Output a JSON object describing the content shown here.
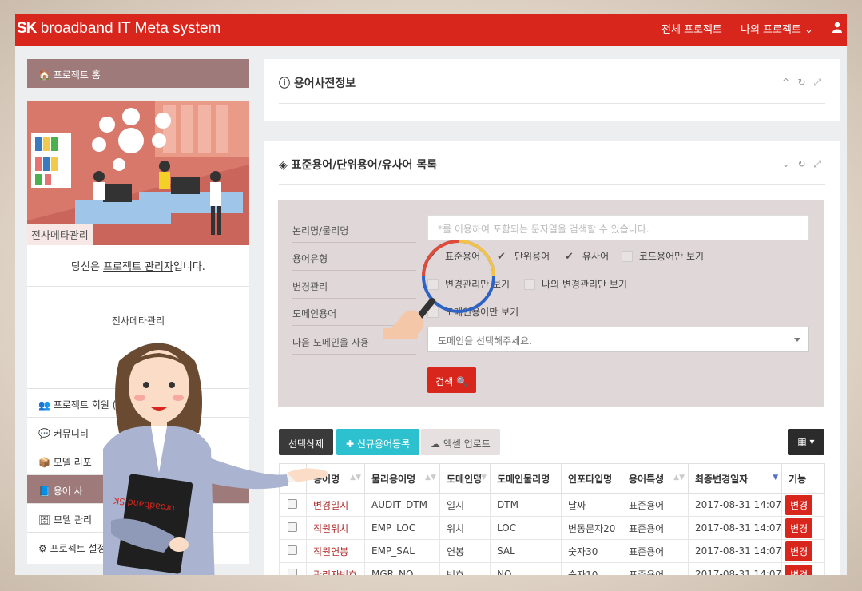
{
  "header": {
    "logo_main": "SK",
    "logo_rest": "broadband IT Meta system",
    "nav_all": "전체 프로젝트",
    "nav_mine": "나의 프로젝트 ⌄",
    "user_icon": "user-icon"
  },
  "sidebar": {
    "home": "🏠 프로젝트 홈",
    "illustration_label": "전사메타관리",
    "manager_prefix": "당신은 ",
    "manager_link": "프로젝트 관리자",
    "manager_suffix": "입니다.",
    "project_name": "전사메타관리",
    "menu": [
      {
        "label": "👥 프로젝트 회원 (1 /"
      },
      {
        "label": "💬 커뮤니티"
      },
      {
        "label": "📦 모델 리포"
      },
      {
        "label": "📘 용어 사"
      },
      {
        "label": "🗄 모델 관리"
      },
      {
        "label": "⚙ 프로젝트 설정"
      }
    ]
  },
  "panel1": {
    "title": "ⓘ 용어사전정보",
    "tools": "^ ↻ ⤢"
  },
  "panel2": {
    "title": "◈ 표준용어/단위용어/유사어 목록",
    "tools": "⌄ ↻ ⤢"
  },
  "search": {
    "labels": [
      "논리명/물리명",
      "용어유형",
      "변경관리",
      "도메인용어",
      "다음 도메인을 사용"
    ],
    "input_placeholder": "*를 이용하여 포함되는 문자열을 검색할 수 있습니다.",
    "type_options": [
      {
        "label": "표준용어",
        "checked": true
      },
      {
        "label": "단위용어",
        "checked": true
      },
      {
        "label": "유사어",
        "checked": true
      },
      {
        "label": "코드용어만 보기",
        "checked": false
      }
    ],
    "change_options": [
      {
        "label": "변경관리만 보기",
        "checked": false
      },
      {
        "label": "나의 변경관리만 보기",
        "checked": false
      }
    ],
    "domain_option": {
      "label": "도메인용어만 보기",
      "checked": false
    },
    "domain_select": "도메인을 선택해주세요.",
    "search_button": "검색 🔍"
  },
  "actions": {
    "delete_selected": "선택삭제",
    "new_term": "✚ 신규용어등록",
    "excel_upload": "☁ 엑셀 업로드",
    "grid": "▦ ▾"
  },
  "table": {
    "headers": [
      "용어명",
      "물리용어명",
      "도메인명",
      "도메인물리명",
      "인포타입명",
      "용어특성",
      "최종변경일자",
      "기능"
    ],
    "rows": [
      [
        "변경일시",
        "AUDIT_DTM",
        "일시",
        "DTM",
        "날짜",
        "표준용어",
        "2017-08-31 14:07",
        "변경"
      ],
      [
        "직원위치",
        "EMP_LOC",
        "위치",
        "LOC",
        "변동문자20",
        "표준용어",
        "2017-08-31 14:07",
        "변경"
      ],
      [
        "직원연봉",
        "EMP_SAL",
        "연봉",
        "SAL",
        "숫자30",
        "표준용어",
        "2017-08-31 14:07",
        "변경"
      ],
      [
        "관리자번호",
        "MGR_NO",
        "번호",
        "NO",
        "숫자10",
        "표준용어",
        "2017-08-31 14:07",
        "변경"
      ]
    ]
  },
  "overlay": {
    "clipboard_text": "broadband SK"
  },
  "colors": {
    "brand_red": "#d9261c",
    "sidebar_brown": "#9e7a7a",
    "accent_cyan": "#2dc1cf"
  }
}
